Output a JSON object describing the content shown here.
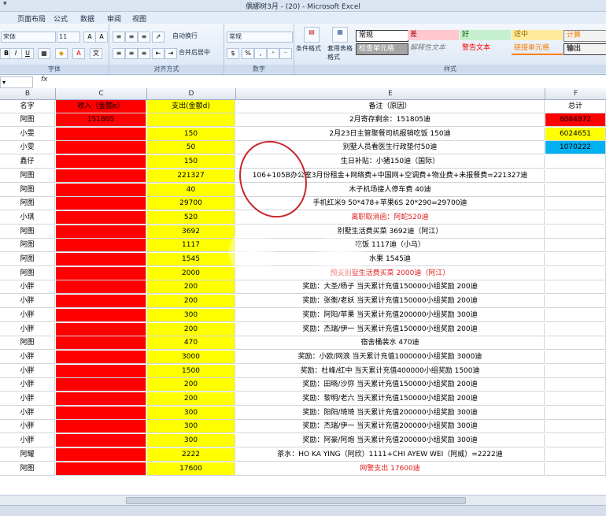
{
  "window": {
    "title": "偶娜树3月 - (20) - Microsoft Excel",
    "quick": "▾"
  },
  "menu": [
    "页面布局",
    "公式",
    "数据",
    "审阅",
    "视图"
  ],
  "ribbon": {
    "font_name": "宋体",
    "font_size": "11",
    "wrap_text": "自动换行",
    "merge_center": "合并后居中",
    "number_format": "常规",
    "number_symbols": [
      "%",
      ","
    ],
    "conditional_format": "条件格式",
    "table_format": "套用表格格式",
    "group_labels": {
      "font": "字体",
      "align": "对齐方式",
      "number": "数字",
      "styles": "样式"
    },
    "styles": [
      {
        "label": "常规",
        "color": "#ffffff"
      },
      {
        "label": "差",
        "color": "#ffc7ce"
      },
      {
        "label": "好",
        "color": "#c6efce"
      },
      {
        "label": "适中",
        "color": "#ffeb9c"
      },
      {
        "label": "计算",
        "color": "#f2f2f2"
      },
      {
        "label": "检查单元格",
        "color": "#a5a5a5"
      },
      {
        "label": "解释性文本",
        "color": "#ffffff"
      },
      {
        "label": "警告文本",
        "color": "#ffffff"
      },
      {
        "label": "链接单元格",
        "color": "#ffffff"
      },
      {
        "label": "输出",
        "color": "#f2f2f2"
      }
    ]
  },
  "formula_bar": {
    "name_box": "▾",
    "fx": "fx",
    "value": ""
  },
  "columns": [
    "B",
    "C",
    "D",
    "E",
    "F"
  ],
  "header_row": {
    "b": "名字",
    "c": "收入（金额e）",
    "d": "支出(金额d)",
    "e": "备注（原因）",
    "f": "总计"
  },
  "rows": [
    {
      "b": "阿图",
      "c": "151805",
      "d": "",
      "e": "2月寄存剩余：151805迪",
      "f": "6084872",
      "ef": "",
      "fc": "red"
    },
    {
      "b": "小雯",
      "c": "",
      "d": "150",
      "e": "2月23日主管聚餐司机报销吃饭 150迪",
      "f": "6024651",
      "ef": "",
      "fc": "yel"
    },
    {
      "b": "小雯",
      "c": "",
      "d": "50",
      "e": "别墅人员看医生行政垫付50迪",
      "f": "1070222",
      "ef": "",
      "fc": "cyan"
    },
    {
      "b": "鑫仔",
      "c": "",
      "d": "150",
      "e": "生日补贴：小猪150迪（国际）",
      "f": "",
      "ef": "",
      "fc": ""
    },
    {
      "b": "阿图",
      "c": "",
      "d": "221327",
      "e": "106+105B办公室3月份租金+网络费+中国网+空调费+物业费+未报餐费=221327迪",
      "f": "",
      "ef": "",
      "fc": ""
    },
    {
      "b": "阿图",
      "c": "",
      "d": "40",
      "e": "木子机场接人停车费 40迪",
      "f": "",
      "ef": "",
      "fc": ""
    },
    {
      "b": "阿图",
      "c": "",
      "d": "29700",
      "e": "手机红米9 50*478+苹果6S 20*290=29700迪",
      "f": "",
      "ef": "",
      "fc": ""
    },
    {
      "b": "小琪",
      "c": "",
      "d": "520",
      "e": "离职取消函：阿蛇520迪",
      "f": "",
      "ef": "red",
      "fc": ""
    },
    {
      "b": "阿图",
      "c": "",
      "d": "3692",
      "e": "别墅生活费买菜 3692迪（阿江）",
      "f": "",
      "ef": "",
      "fc": ""
    },
    {
      "b": "阿图",
      "c": "",
      "d": "1117",
      "e": "吃饭 1117迪（小马）",
      "f": "",
      "ef": "",
      "fc": ""
    },
    {
      "b": "阿图",
      "c": "",
      "d": "1545",
      "e": "水果 1545迪",
      "f": "",
      "ef": "",
      "fc": ""
    },
    {
      "b": "阿图",
      "c": "",
      "d": "2000",
      "e": "预支别墅生活费买菜 2000迪（阿江）",
      "f": "",
      "ef": "red",
      "fc": ""
    },
    {
      "b": "小胖",
      "c": "",
      "d": "200",
      "e": "奖励：大圣/杨子 当天累计充值150000小组奖励 200迪",
      "f": "",
      "ef": "",
      "fc": ""
    },
    {
      "b": "小胖",
      "c": "",
      "d": "200",
      "e": "奖励：张衡/老妖 当天累计充值150000小组奖励 200迪",
      "f": "",
      "ef": "",
      "fc": ""
    },
    {
      "b": "小胖",
      "c": "",
      "d": "300",
      "e": "奖励：阿阳/苹果 当天累计充值200000小组奖励 300迪",
      "f": "",
      "ef": "",
      "fc": ""
    },
    {
      "b": "小胖",
      "c": "",
      "d": "200",
      "e": "奖励：杰瑞/伊一 当天累计充值150000小组奖励 200迪",
      "f": "",
      "ef": "",
      "fc": ""
    },
    {
      "b": "阿图",
      "c": "",
      "d": "470",
      "e": "宿舍桶装水 470迪",
      "f": "",
      "ef": "",
      "fc": ""
    },
    {
      "b": "小胖",
      "c": "",
      "d": "3000",
      "e": "奖励：小欧/网浪 当天累计充值1000000小组奖励 3000迪",
      "f": "",
      "ef": "",
      "fc": ""
    },
    {
      "b": "小胖",
      "c": "",
      "d": "1500",
      "e": "奖励：杜峰/红中 当天累计充值400000小组奖励 1500迪",
      "f": "",
      "ef": "",
      "fc": ""
    },
    {
      "b": "小胖",
      "c": "",
      "d": "200",
      "e": "奖励：田晓/沙弥 当天累计充值150000小组奖励 200迪",
      "f": "",
      "ef": "",
      "fc": ""
    },
    {
      "b": "小胖",
      "c": "",
      "d": "200",
      "e": "奖励：黎明/老六 当天累计充值150000小组奖励 200迪",
      "f": "",
      "ef": "",
      "fc": ""
    },
    {
      "b": "小胖",
      "c": "",
      "d": "300",
      "e": "奖励：阳阳/琦琦 当天累计充值200000小组奖励 300迪",
      "f": "",
      "ef": "",
      "fc": ""
    },
    {
      "b": "小胖",
      "c": "",
      "d": "300",
      "e": "奖励：杰瑞/伊一 当天累计充值200000小组奖励 300迪",
      "f": "",
      "ef": "",
      "fc": ""
    },
    {
      "b": "小胖",
      "c": "",
      "d": "300",
      "e": "奖励：阿豪/阿炮 当天累计充值200000小组奖励 300迪",
      "f": "",
      "ef": "",
      "fc": ""
    },
    {
      "b": "阿耀",
      "c": "",
      "d": "2222",
      "e": "茶水：HO KA YING（阿欣）1111+CHI AYEW WEI（阿威）=2222迪",
      "f": "",
      "ef": "",
      "fc": ""
    },
    {
      "b": "阿图",
      "c": "",
      "d": "17600",
      "e": "网警支出 17600迪",
      "f": "",
      "ef": "red",
      "fc": ""
    }
  ]
}
